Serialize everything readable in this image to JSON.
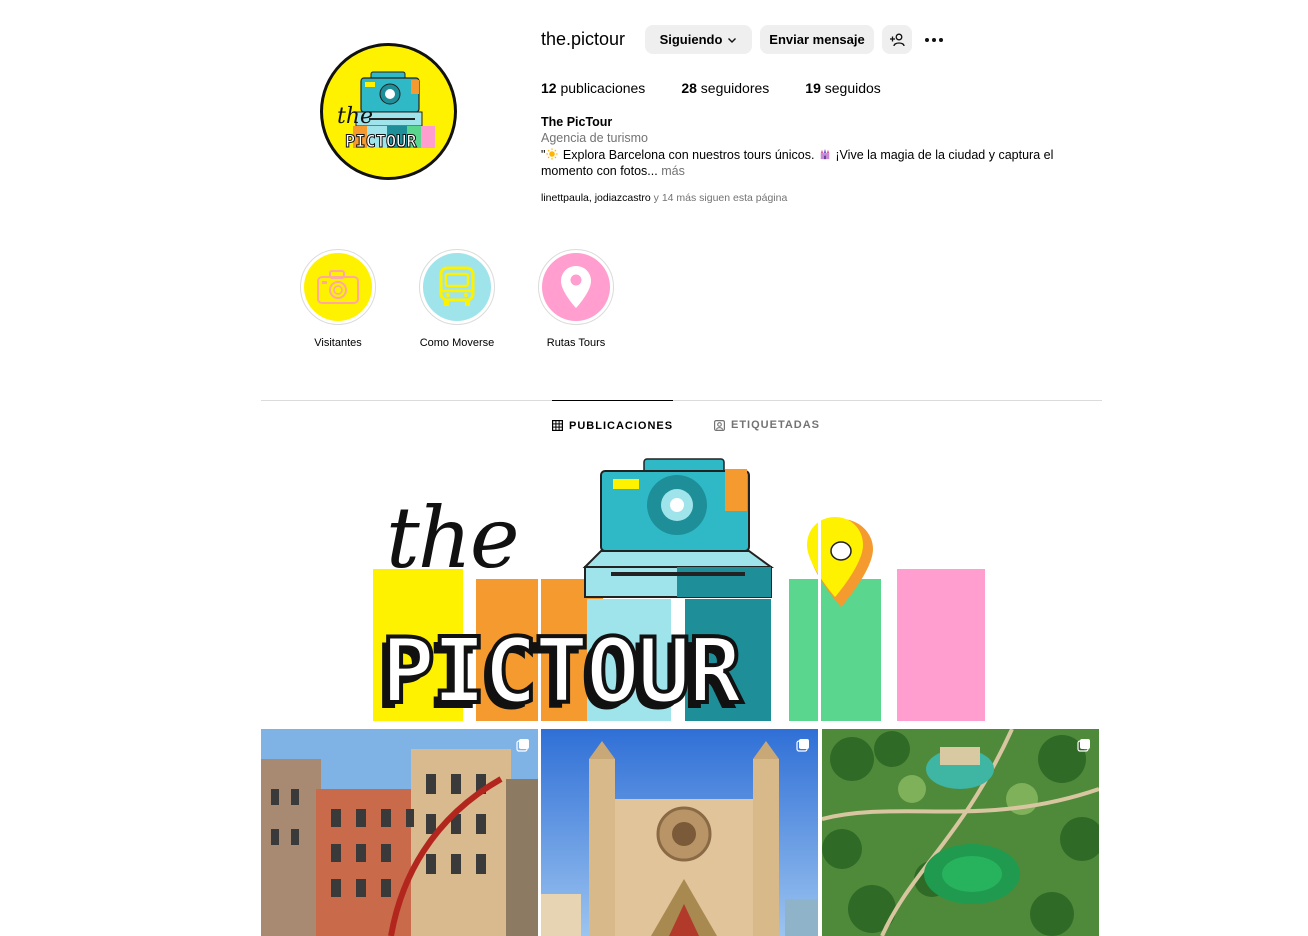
{
  "profile": {
    "username": "the.pictour",
    "following_button": "Siguiendo",
    "message_button": "Enviar mensaje",
    "avatar_text_top": "the",
    "avatar_text_bottom": "PICTOUR"
  },
  "stats": {
    "posts_count": "12",
    "posts_label": "publicaciones",
    "followers_count": "28",
    "followers_label": "seguidores",
    "following_count": "19",
    "following_label": "seguidos"
  },
  "bio": {
    "name": "The PicTour",
    "category": "Agencia de turismo",
    "text_prefix": "\"",
    "text_part1": " Explora Barcelona con nuestros tours únicos. ",
    "text_part2": " ¡Vive la magia de la ciudad y captura el momento con fotos...",
    "more_label": " más",
    "followed_by_names": "linettpaula, jodiazcastro",
    "followed_by_rest": " y 14 más siguen esta página"
  },
  "highlights": [
    {
      "label": "Visitantes",
      "color": "#fff200",
      "icon": "camera-icon"
    },
    {
      "label": "Como Moverse",
      "color": "#9ee4ea",
      "icon": "bus-icon"
    },
    {
      "label": "Rutas Tours",
      "color": "#ff9ecf",
      "icon": "map-pin-icon"
    }
  ],
  "tabs": {
    "posts": "PUBLICACIONES",
    "tagged": "ETIQUETADAS"
  },
  "banner": {
    "script_text": "the",
    "logo_text": "PICTOUR"
  },
  "posts": [
    {
      "name": "barcelona-street-post",
      "multi": true
    },
    {
      "name": "santa-maria-del-mar-post",
      "multi": true
    },
    {
      "name": "parc-ciutadella-aerial-post",
      "multi": true
    }
  ],
  "colors": {
    "brand_yellow": "#fff200",
    "brand_teal": "#2fb9c6",
    "brand_orange": "#f59a2e",
    "brand_pink": "#ff9ecf",
    "brand_green": "#5ad68f",
    "muted_text": "#737373"
  }
}
